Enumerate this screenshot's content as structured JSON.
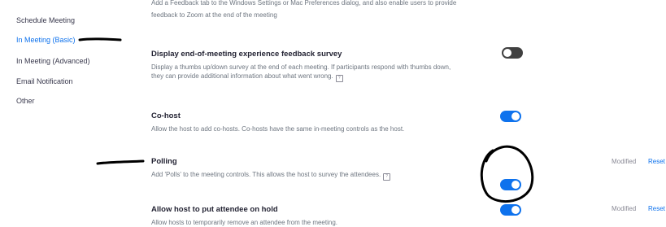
{
  "sidebar": {
    "items": [
      {
        "label": "Schedule Meeting",
        "active": false
      },
      {
        "label": "In Meeting (Basic)",
        "active": true
      },
      {
        "label": "In Meeting (Advanced)",
        "active": false
      },
      {
        "label": "Email Notification",
        "active": false
      },
      {
        "label": "Other",
        "active": false
      }
    ]
  },
  "settings": {
    "feedback_tab": {
      "desc_partial_top": "Add a Feedback tab to the Windows Settings or Mac Preferences dialog, and also enable users to provide",
      "desc_partial_bottom": "feedback to Zoom at the end of the meeting"
    },
    "end_survey": {
      "title": "Display end-of-meeting experience feedback survey",
      "desc_line1": "Display a thumbs up/down survey at the end of each meeting. If participants respond with thumbs down,",
      "desc_line2": "they can provide additional information about what went wrong.",
      "enabled": false
    },
    "cohost": {
      "title": "Co-host",
      "desc": "Allow the host to add co-hosts. Co-hosts have the same in-meeting controls as the host.",
      "enabled": true
    },
    "polling": {
      "title": "Polling",
      "desc": "Add 'Polls' to the meeting controls. This allows the host to survey the attendees.",
      "enabled": true,
      "modified_label": "Modified",
      "reset_label": "Reset"
    },
    "attendee_hold": {
      "title": "Allow host to put attendee on hold",
      "desc": "Allow hosts to temporarily remove an attendee from the meeting.",
      "enabled": true,
      "modified_label": "Modified",
      "reset_label": "Reset"
    }
  },
  "icons": {
    "info": "info-icon"
  },
  "colors": {
    "accent": "#0e72ed",
    "toggle_off": "#404040",
    "annotation_ink": "#000000"
  }
}
